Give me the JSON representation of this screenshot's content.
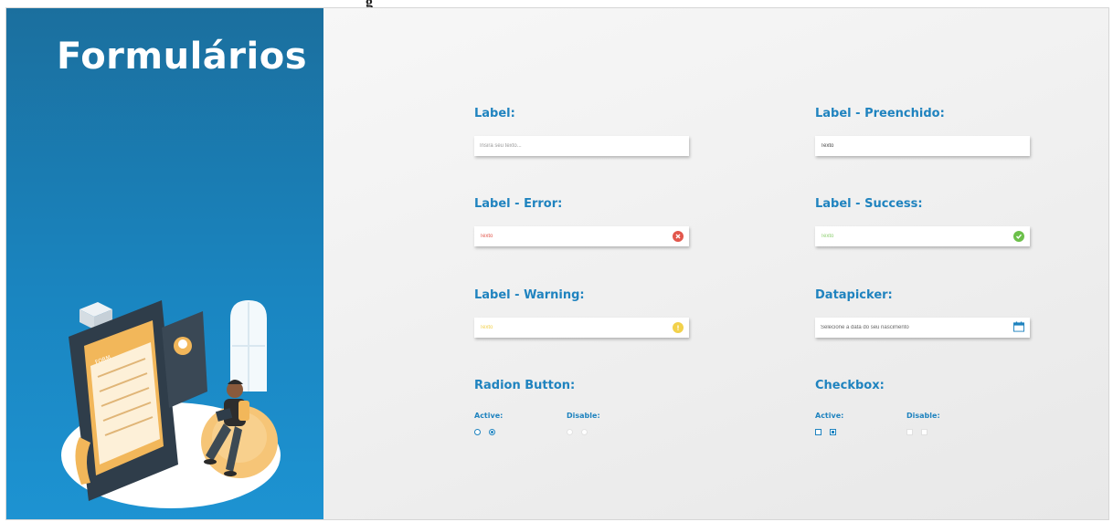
{
  "top_fragment": "g",
  "sidebar": {
    "title": "Formulários",
    "illustration": {
      "icon": "form-illustration",
      "form_header": "FORM"
    }
  },
  "form": {
    "default": {
      "label": "Label:",
      "placeholder": "Insira seu texto..."
    },
    "filled": {
      "label": "Label - Preenchido:",
      "value": "Texto"
    },
    "error": {
      "label": "Label - Error:",
      "value": "Texto",
      "icon": "error-circle-icon",
      "color": "#e2574c"
    },
    "success": {
      "label": "Label - Success:",
      "value": "Texto",
      "icon": "check-circle-icon",
      "color": "#6cc04a"
    },
    "warning": {
      "label": "Label - Warning:",
      "value": "Texto",
      "icon": "warning-circle-icon",
      "color": "#f2d14b"
    },
    "datepicker": {
      "label": "Datapicker:",
      "placeholder": "Selecione a data do seu nascimento",
      "icon": "calendar-icon"
    },
    "radio": {
      "title": "Radion Button:",
      "active_label": "Active:",
      "disable_label": "Disable:",
      "active_states": [
        "unchecked",
        "checked"
      ],
      "disabled_states": [
        "unchecked",
        "checked"
      ]
    },
    "checkbox": {
      "title": "Checkbox:",
      "active_label": "Active:",
      "disable_label": "Disable:",
      "active_states": [
        "unchecked",
        "checked"
      ],
      "disabled_states": [
        "unchecked",
        "checked"
      ]
    }
  },
  "colors": {
    "accent": "#1f83bf",
    "sidebar_top": "#1b6f9e",
    "sidebar_bottom": "#1d93d2"
  }
}
